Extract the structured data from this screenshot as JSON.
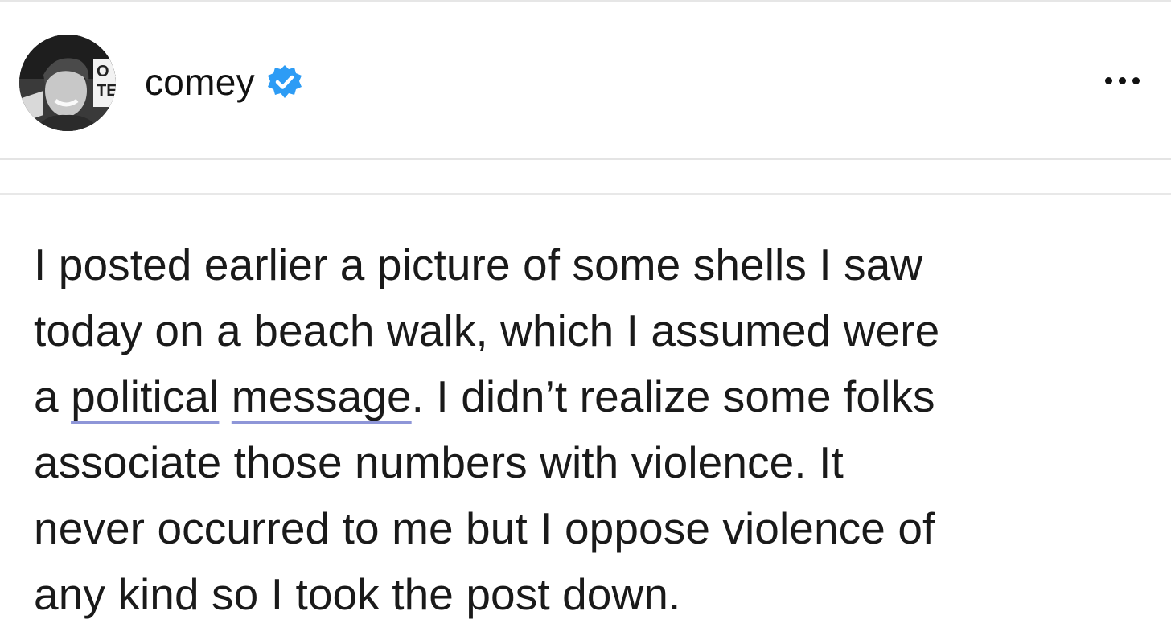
{
  "post": {
    "username": "comey",
    "verified_icon": "verified-badge-icon",
    "more_icon": "more-options-icon",
    "colors": {
      "verified_blue": "#2d9cf5",
      "underline": "#8e96d8"
    },
    "text": {
      "line1": "I posted earlier a picture of some shells I saw",
      "line2": "today on a beach walk, which I assumed were",
      "line3_prefix": "a ",
      "line3_link1": "political",
      "line3_space": " ",
      "line3_link2": "message",
      "line3_suffix": ". I didn’t realize some folks",
      "line4": "associate those numbers with violence. It",
      "line5": "never occurred to me but I oppose violence of",
      "line6": "any kind so I took the post down."
    }
  }
}
